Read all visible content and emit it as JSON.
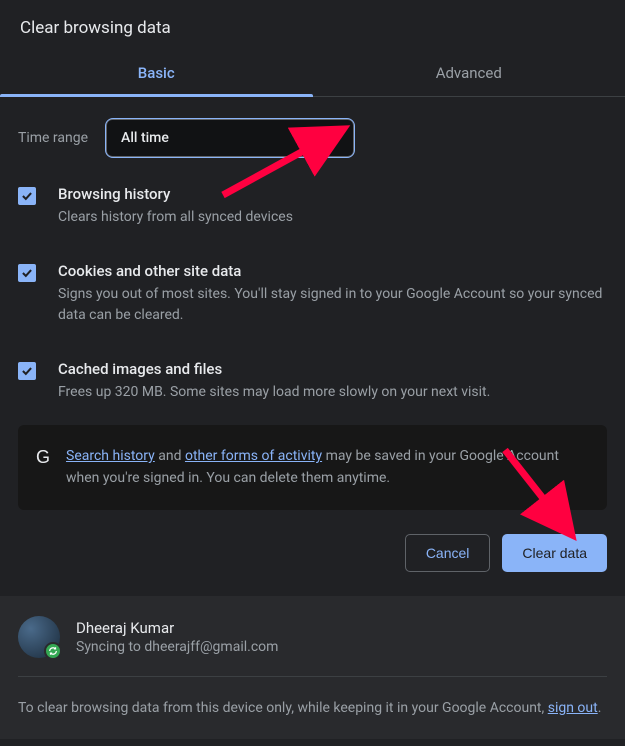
{
  "dialog": {
    "title": "Clear browsing data"
  },
  "tabs": {
    "basic": "Basic",
    "advanced": "Advanced"
  },
  "time_range": {
    "label": "Time range",
    "value": "All time"
  },
  "options": {
    "browsing_history": {
      "title": "Browsing history",
      "desc": "Clears history from all synced devices"
    },
    "cookies": {
      "title": "Cookies and other site data",
      "desc": "Signs you out of most sites. You'll stay signed in to your Google Account so your synced data can be cleared."
    },
    "cache": {
      "title": "Cached images and files",
      "desc": "Frees up 320 MB. Some sites may load more slowly on your next visit."
    }
  },
  "info": {
    "link1": "Search history",
    "mid1": " and ",
    "link2": "other forms of activity",
    "rest": " may be saved in your Google Account when you're signed in. You can delete them anytime."
  },
  "buttons": {
    "cancel": "Cancel",
    "clear": "Clear data"
  },
  "account": {
    "name": "Dheeraj Kumar",
    "sync_text": "Syncing to dheerajff@gmail.com"
  },
  "footer": {
    "text1": "To clear browsing data from this device only, while keeping it in your Google Account, ",
    "link": "sign out",
    "text2": "."
  }
}
